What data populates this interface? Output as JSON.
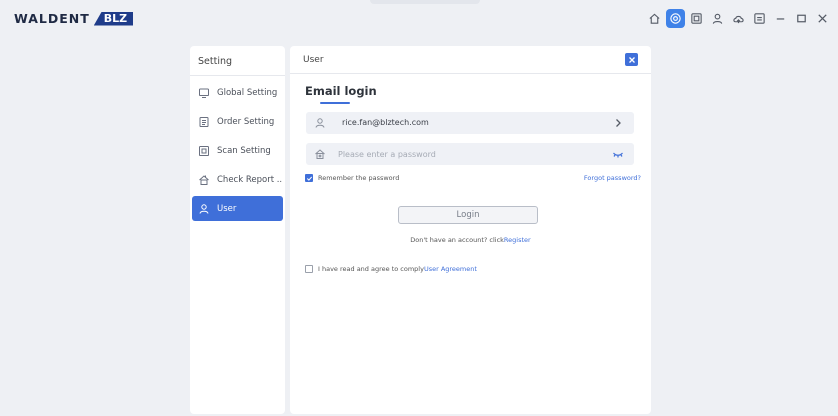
{
  "brand": {
    "name": "WALDENT",
    "badge": "BLZ"
  },
  "window_controls": [
    {
      "name": "home-icon",
      "active": false
    },
    {
      "name": "target-icon",
      "active": true
    },
    {
      "name": "frame-icon",
      "active": false
    },
    {
      "name": "user-icon",
      "active": false
    },
    {
      "name": "cloud-icon",
      "active": false
    },
    {
      "name": "transfer-icon",
      "active": false
    },
    {
      "name": "minimize-icon",
      "active": false
    },
    {
      "name": "maximize-icon",
      "active": false
    },
    {
      "name": "close-window-icon",
      "active": false
    }
  ],
  "nav": {
    "title": "Setting",
    "items": [
      {
        "label": "Global Setting",
        "icon": "monitor-icon",
        "active": false
      },
      {
        "label": "Order Setting",
        "icon": "document-icon",
        "active": false
      },
      {
        "label": "Scan Setting",
        "icon": "scan-icon",
        "active": false
      },
      {
        "label": "Check Report ...",
        "icon": "report-icon",
        "active": false
      },
      {
        "label": "User",
        "icon": "user-icon",
        "active": true
      }
    ]
  },
  "panel": {
    "title": "User",
    "email_login_title": "Email login",
    "email_value": "rice.fan@blztech.com",
    "password_placeholder": "Please enter a password",
    "remember_label": "Remember the password",
    "remember_checked": true,
    "forgot_label": "Forgot password?",
    "login_label": "Login",
    "no_account_text": "Don't have an account? click",
    "register_label": "Register",
    "agree_text": "I have read and agree to comply",
    "agreement_label": "User Agreement",
    "agree_checked": false
  },
  "colors": {
    "accent": "#3f6fd9",
    "background": "#eef0f4",
    "brand_badge": "#1f3c8a"
  }
}
